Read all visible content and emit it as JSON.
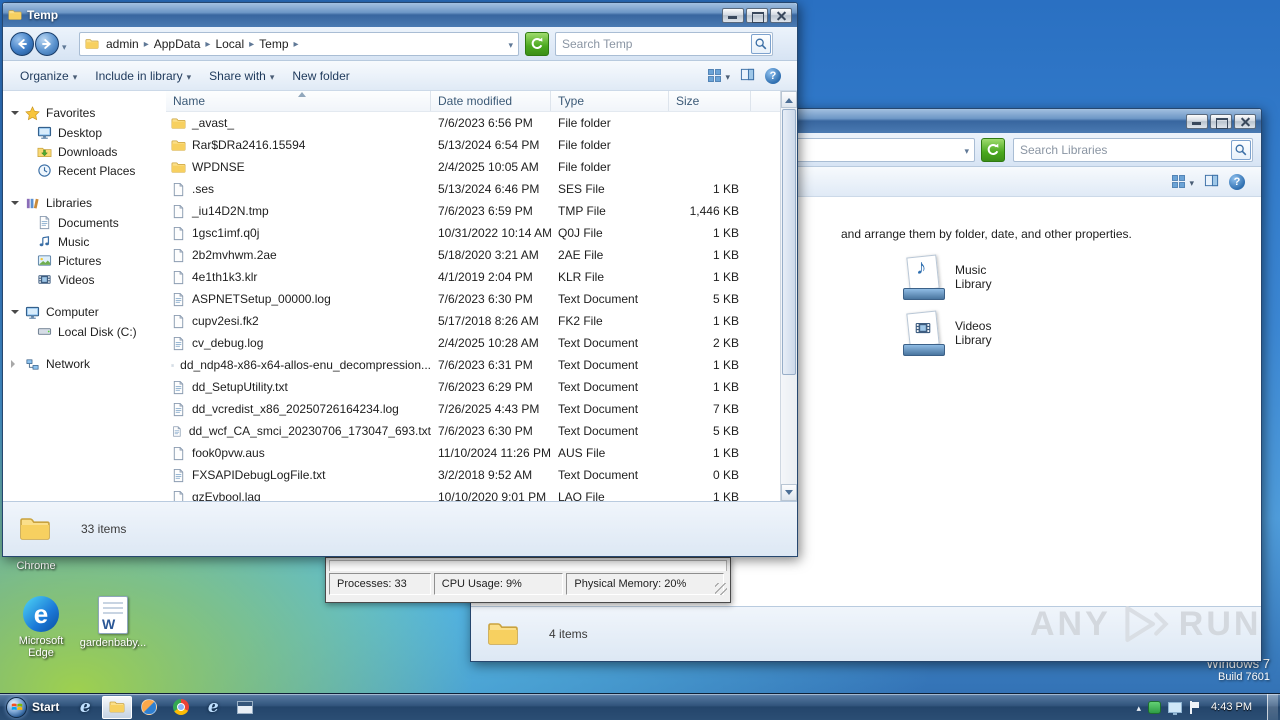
{
  "colors": {
    "accent_blue": "#3a6ea5",
    "titlebar_blue": "#38669f",
    "folder_yellow": "#f7d060",
    "refresh_green": "#4aa81f",
    "taskbar_blue": "#2b4e74",
    "desktop_green": "#8dc63f"
  },
  "temp_window": {
    "title": "Temp",
    "breadcrumb": {
      "segments": [
        "admin",
        "AppData",
        "Local",
        "Temp"
      ]
    },
    "search": {
      "placeholder": "Search Temp"
    },
    "toolbar": {
      "items": [
        {
          "label": "Organize",
          "caret": true
        },
        {
          "label": "Include in library",
          "caret": true
        },
        {
          "label": "Share with",
          "caret": true
        },
        {
          "label": "New folder",
          "caret": false
        }
      ]
    },
    "sidebar": {
      "sections": [
        {
          "label": "Favorites",
          "icon": "star",
          "expanded": true,
          "items": [
            {
              "label": "Desktop",
              "icon": "monitor"
            },
            {
              "label": "Downloads",
              "icon": "downloads"
            },
            {
              "label": "Recent Places",
              "icon": "recent"
            }
          ]
        },
        {
          "label": "Libraries",
          "icon": "library",
          "expanded": true,
          "items": [
            {
              "label": "Documents",
              "icon": "documents"
            },
            {
              "label": "Music",
              "icon": "music"
            },
            {
              "label": "Pictures",
              "icon": "pictures"
            },
            {
              "label": "Videos",
              "icon": "videos"
            }
          ]
        },
        {
          "label": "Computer",
          "icon": "computer",
          "expanded": true,
          "items": [
            {
              "label": "Local Disk (C:)",
              "icon": "drive"
            }
          ]
        },
        {
          "label": "Network",
          "icon": "network",
          "expanded": false,
          "items": []
        }
      ]
    },
    "columns": [
      {
        "label": "Name",
        "sorted": "asc"
      },
      {
        "label": "Date modified"
      },
      {
        "label": "Type"
      },
      {
        "label": "Size"
      }
    ],
    "files": [
      {
        "name": "_avast_",
        "date": "7/6/2023 6:56 PM",
        "type": "File folder",
        "size": "",
        "icon": "folder"
      },
      {
        "name": "Rar$DRa2416.15594",
        "date": "5/13/2024 6:54 PM",
        "type": "File folder",
        "size": "",
        "icon": "folder"
      },
      {
        "name": "WPDNSE",
        "date": "2/4/2025 10:05 AM",
        "type": "File folder",
        "size": "",
        "icon": "folder"
      },
      {
        "name": ".ses",
        "date": "5/13/2024 6:46 PM",
        "type": "SES File",
        "size": "1 KB",
        "icon": "file"
      },
      {
        "name": "_iu14D2N.tmp",
        "date": "7/6/2023 6:59 PM",
        "type": "TMP File",
        "size": "1,446 KB",
        "icon": "file"
      },
      {
        "name": "1gsc1imf.q0j",
        "date": "10/31/2022 10:14 AM",
        "type": "Q0J File",
        "size": "1 KB",
        "icon": "file"
      },
      {
        "name": "2b2mvhwm.2ae",
        "date": "5/18/2020 3:21 AM",
        "type": "2AE File",
        "size": "1 KB",
        "icon": "file"
      },
      {
        "name": "4e1th1k3.klr",
        "date": "4/1/2019 2:04 PM",
        "type": "KLR File",
        "size": "1 KB",
        "icon": "file"
      },
      {
        "name": "ASPNETSetup_00000.log",
        "date": "7/6/2023 6:30 PM",
        "type": "Text Document",
        "size": "5 KB",
        "icon": "text"
      },
      {
        "name": "cupv2esi.fk2",
        "date": "5/17/2018 8:26 AM",
        "type": "FK2 File",
        "size": "1 KB",
        "icon": "file"
      },
      {
        "name": "cv_debug.log",
        "date": "2/4/2025 10:28 AM",
        "type": "Text Document",
        "size": "2 KB",
        "icon": "text"
      },
      {
        "name": "dd_ndp48-x86-x64-allos-enu_decompression...",
        "date": "7/6/2023 6:31 PM",
        "type": "Text Document",
        "size": "1 KB",
        "icon": "text"
      },
      {
        "name": "dd_SetupUtility.txt",
        "date": "7/6/2023 6:29 PM",
        "type": "Text Document",
        "size": "1 KB",
        "icon": "text"
      },
      {
        "name": "dd_vcredist_x86_20250726164234.log",
        "date": "7/26/2025 4:43 PM",
        "type": "Text Document",
        "size": "7 KB",
        "icon": "text"
      },
      {
        "name": "dd_wcf_CA_smci_20230706_173047_693.txt",
        "date": "7/6/2023 6:30 PM",
        "type": "Text Document",
        "size": "5 KB",
        "icon": "text"
      },
      {
        "name": "fook0pvw.aus",
        "date": "11/10/2024 11:26 PM",
        "type": "AUS File",
        "size": "1 KB",
        "icon": "file"
      },
      {
        "name": "FXSAPIDebugLogFile.txt",
        "date": "3/2/2018 9:52 AM",
        "type": "Text Document",
        "size": "0 KB",
        "icon": "text"
      },
      {
        "name": "gzEvbool.laq",
        "date": "10/10/2020 9:01 PM",
        "type": "LAQ File",
        "size": "1 KB",
        "icon": "file"
      }
    ],
    "status": {
      "items_count": "33 items"
    }
  },
  "libraries_window": {
    "search": {
      "placeholder": "Search Libraries"
    },
    "hint": "and arrange them by folder, date, and other properties.",
    "items": [
      {
        "label": "Music Library",
        "icon": "music-library-icon"
      },
      {
        "label": "Videos Library",
        "icon": "videos-library-icon"
      }
    ],
    "status": {
      "items_count": "4 items"
    }
  },
  "task_manager": {
    "cells": [
      "Processes: 33",
      "CPU Usage: 9%",
      "Physical Memory: 20%"
    ]
  },
  "desktop": {
    "icons": [
      {
        "label": "Chrome",
        "kind": "chrome"
      },
      {
        "label": "Microsoft Edge",
        "kind": "edge"
      },
      {
        "label": "gardenbaby...",
        "kind": "word"
      }
    ],
    "os_label": "Windows 7",
    "build_label": "Build 7601",
    "watermark_left": "ANY",
    "watermark_right": "RUN"
  },
  "taskbar": {
    "start_label": "Start",
    "apps": [
      "internet-explorer",
      "windows-explorer",
      "media-player",
      "browser",
      "internet-explorer-2",
      "app-window"
    ],
    "active_app": "windows-explorer",
    "tray": [
      "hidden-icons",
      "agent-status",
      "network",
      "action-center"
    ],
    "clock": "4:43 PM"
  }
}
